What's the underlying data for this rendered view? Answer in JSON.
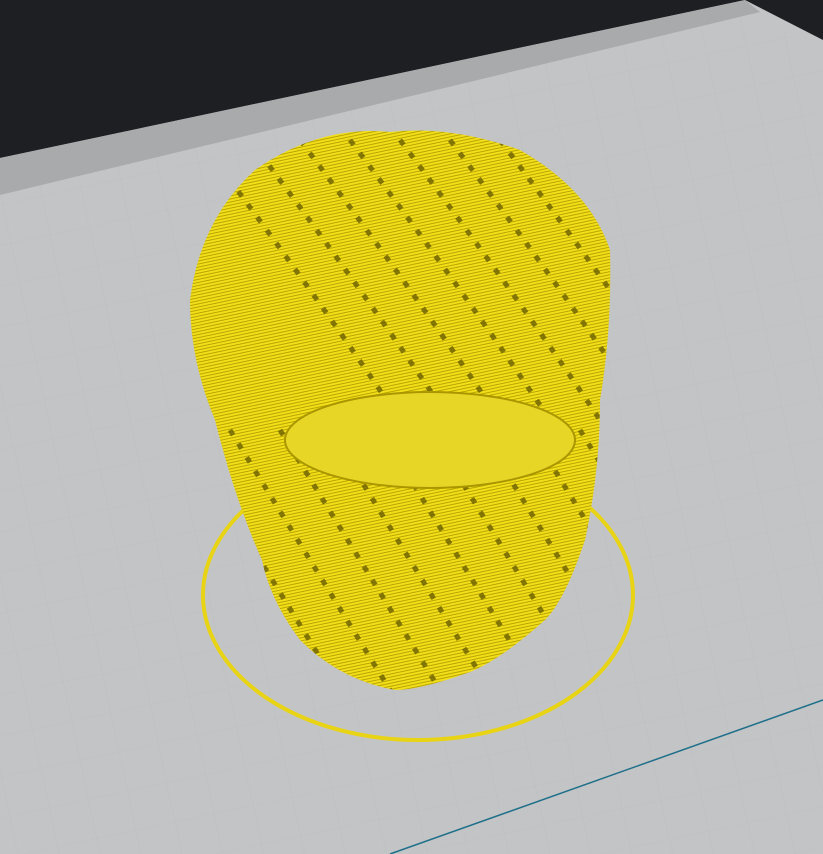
{
  "viewport": {
    "background_color": "#1d1f22",
    "plate_color": "#c2c3c4",
    "plate_edge_color": "#a9abad",
    "grid_color": "#b6b8ba",
    "model_color": "#f2df1a",
    "model_shadow_color": "#8a7a00",
    "model_dark_color": "#3a3300",
    "skirt_color": "#e8d414",
    "axis_line_color": "#1e6f8a"
  }
}
